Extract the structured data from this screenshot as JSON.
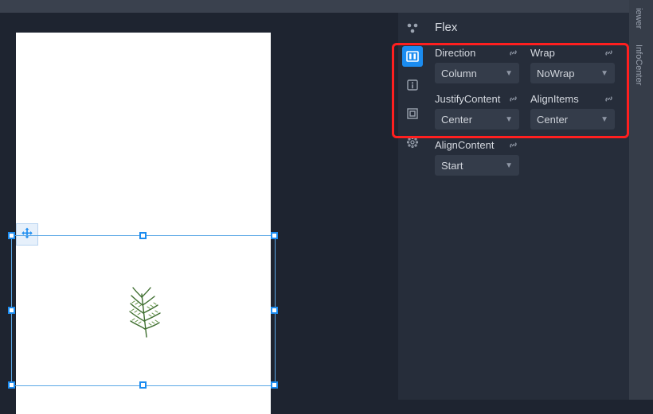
{
  "panel": {
    "title": "Flex",
    "props": {
      "direction": {
        "label": "Direction",
        "value": "Column"
      },
      "wrap": {
        "label": "Wrap",
        "value": "NoWrap"
      },
      "justifyContent": {
        "label": "JustifyContent",
        "value": "Center"
      },
      "alignItems": {
        "label": "AlignItems",
        "value": "Center"
      },
      "alignContent": {
        "label": "AlignContent",
        "value": "Start"
      }
    }
  },
  "sideTabs": {
    "viewer": "iewer",
    "infoCenter": "InfoCenter"
  }
}
